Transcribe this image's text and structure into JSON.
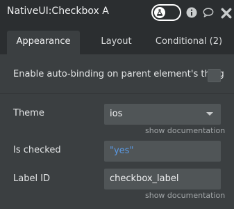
{
  "window": {
    "title": "NativeUI:Checkbox A"
  },
  "header_icons": [
    "info-icon",
    "comment-icon",
    "close-icon"
  ],
  "tabs": [
    {
      "label": "Appearance",
      "active": true
    },
    {
      "label": "Layout",
      "active": false
    },
    {
      "label": "Conditional (2)",
      "active": false
    }
  ],
  "autobinding": {
    "label": "Enable auto-binding on parent element's thing",
    "checked": false
  },
  "theme": {
    "label": "Theme",
    "value": "ios",
    "doc_link": "show documentation"
  },
  "is_checked": {
    "label": "Is checked",
    "value": "\"yes\""
  },
  "label_id": {
    "label": "Label ID",
    "value": "checkbox_label",
    "doc_link": "show documentation"
  },
  "colors": {
    "panel_bg": "#3b3f41",
    "header_bg": "#2b2e30",
    "field_bg": "#505557",
    "dynamic_value": "#5b9be6"
  }
}
